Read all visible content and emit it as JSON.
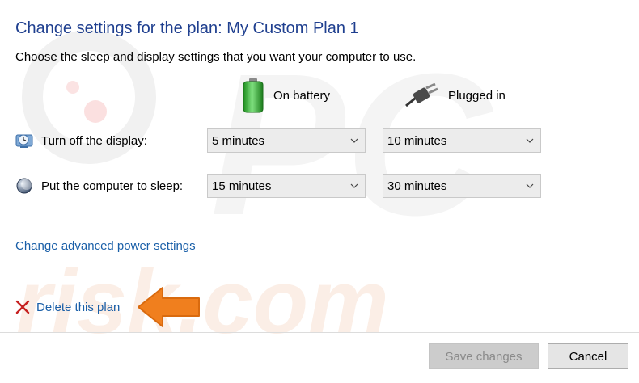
{
  "page": {
    "title": "Change settings for the plan: My Custom Plan 1",
    "subtitle": "Choose the sleep and display settings that you want your computer to use."
  },
  "columns": {
    "battery_label": "On battery",
    "plugged_label": "Plugged in",
    "battery_icon": "battery-icon",
    "plugged_icon": "power-plug-icon"
  },
  "rows": [
    {
      "label": "Turn off the display:",
      "icon": "display-timer-icon",
      "on_battery": "5 minutes",
      "plugged_in": "10 minutes"
    },
    {
      "label": "Put the computer to sleep:",
      "icon": "sleep-moon-icon",
      "on_battery": "15 minutes",
      "plugged_in": "30 minutes"
    }
  ],
  "links": {
    "advanced": "Change advanced power settings",
    "delete": "Delete this plan"
  },
  "buttons": {
    "save": "Save changes",
    "cancel": "Cancel"
  },
  "watermark": {
    "text": "risk.com",
    "logo": "PC"
  },
  "colors": {
    "title": "#1f3f8f",
    "link": "#1a5fa8",
    "arrow": "#f07f1e",
    "delete_x": "#c62020",
    "battery_green": "#3cb93c"
  }
}
